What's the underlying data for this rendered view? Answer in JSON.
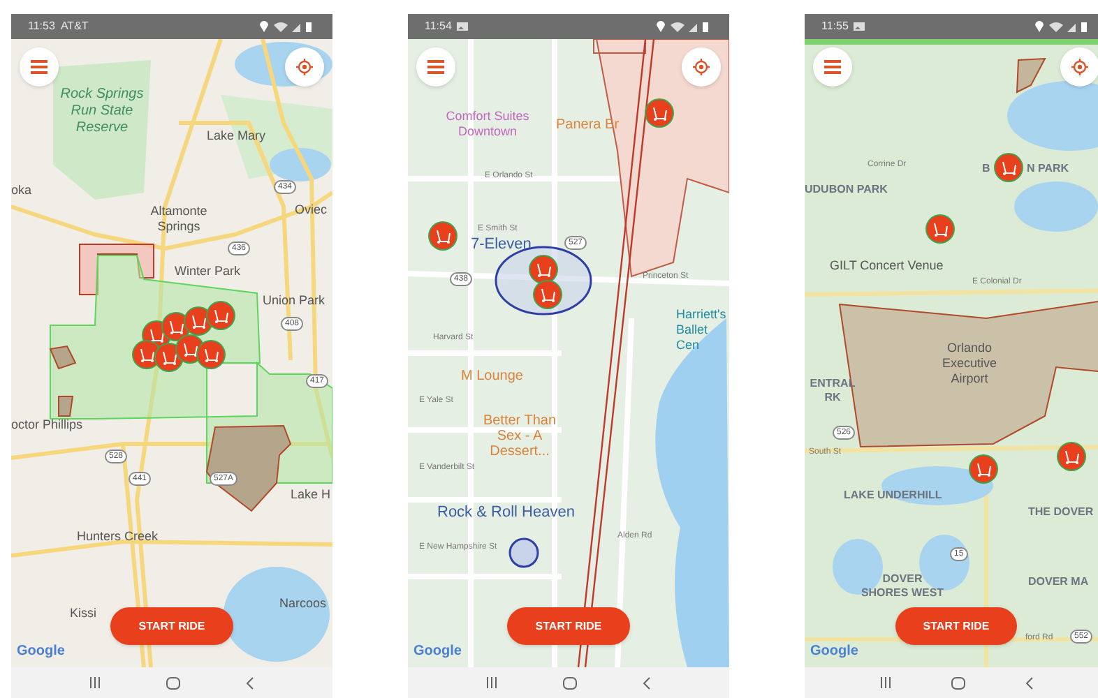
{
  "phones": [
    {
      "status_bar": {
        "time": "11:53",
        "carrier": "AT&T",
        "photo_notification": false
      },
      "map_labels": [
        {
          "text": "Rock Springs Run State Reserve",
          "kind": "park"
        },
        {
          "text": "Lake Mary",
          "kind": "place"
        },
        {
          "text": "oka",
          "kind": "place"
        },
        {
          "text": "Oviec",
          "kind": "place"
        },
        {
          "text": "Altamonte Springs",
          "kind": "place"
        },
        {
          "text": "Winter Park",
          "kind": "place"
        },
        {
          "text": "Union Park",
          "kind": "place"
        },
        {
          "text": "octor Phillips",
          "kind": "place"
        },
        {
          "text": "Lake H",
          "kind": "place"
        },
        {
          "text": "Hunters Creek",
          "kind": "place"
        },
        {
          "text": "Narcoos",
          "kind": "place"
        },
        {
          "text": "Kissi",
          "kind": "place"
        }
      ],
      "route_shields": [
        "434",
        "436",
        "408",
        "417",
        "528",
        "441",
        "527A"
      ],
      "start_button": "START RIDE",
      "attribution": "Google"
    },
    {
      "status_bar": {
        "time": "11:54",
        "photo_notification": true
      },
      "map_labels": [
        {
          "text": "Comfort Suites Downtown",
          "kind": "poi_pink"
        },
        {
          "text": "Panera Br",
          "kind": "poi_orange"
        },
        {
          "text": "E Orlando St",
          "kind": "street"
        },
        {
          "text": "E Smith St",
          "kind": "street"
        },
        {
          "text": "7-Eleven",
          "kind": "poi_blue"
        },
        {
          "text": "Princeton St",
          "kind": "street"
        },
        {
          "text": "Harriett's Ballet Cen",
          "kind": "poi_teal"
        },
        {
          "text": "Harvard St",
          "kind": "street"
        },
        {
          "text": "M Lounge",
          "kind": "poi_orange"
        },
        {
          "text": "E Yale St",
          "kind": "street"
        },
        {
          "text": "Better Than Sex - A Dessert...",
          "kind": "poi_orange"
        },
        {
          "text": "E Vanderbilt St",
          "kind": "street"
        },
        {
          "text": "Rock & Roll Heaven",
          "kind": "poi_blue"
        },
        {
          "text": "Alden Rd",
          "kind": "street"
        },
        {
          "text": "E New Hampshire St",
          "kind": "street"
        }
      ],
      "route_shields": [
        "527",
        "438"
      ],
      "start_button": "START RIDE",
      "attribution": "Google"
    },
    {
      "status_bar": {
        "time": "11:55",
        "photo_notification": true
      },
      "map_labels": [
        {
          "text": "Corrine Dr",
          "kind": "street"
        },
        {
          "text": "B",
          "kind": "district"
        },
        {
          "text": "N PARK",
          "kind": "district"
        },
        {
          "text": "UDUBON PARK",
          "kind": "district"
        },
        {
          "text": "GILT Concert Venue",
          "kind": "place"
        },
        {
          "text": "E Colonial Dr",
          "kind": "street"
        },
        {
          "text": "Orlando Executive Airport",
          "kind": "place"
        },
        {
          "text": "ENTRAL RK",
          "kind": "district"
        },
        {
          "text": "South St",
          "kind": "street"
        },
        {
          "text": "LAKE UNDERHILL",
          "kind": "district"
        },
        {
          "text": "THE DOVER",
          "kind": "district"
        },
        {
          "text": "DOVER SHORES WEST",
          "kind": "district"
        },
        {
          "text": "DOVER MA",
          "kind": "district"
        },
        {
          "text": "ford Rd",
          "kind": "street"
        }
      ],
      "route_shields": [
        "526",
        "15",
        "552"
      ],
      "start_button": "START RIDE",
      "attribution": "Google"
    }
  ]
}
